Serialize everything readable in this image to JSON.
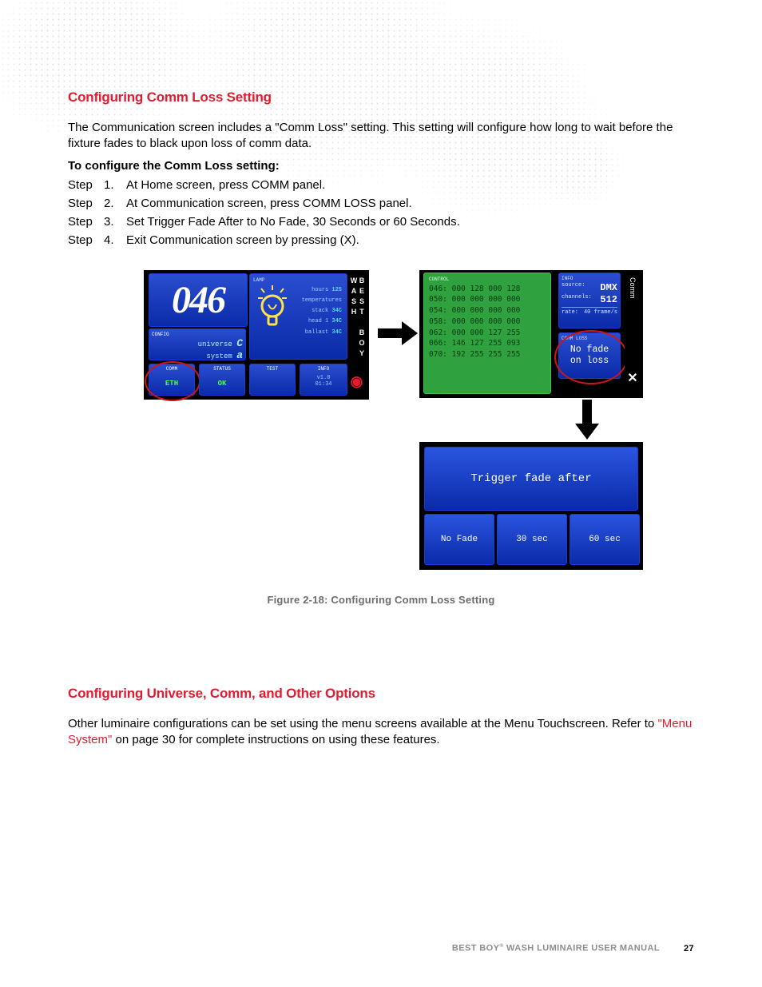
{
  "section1": {
    "heading": "Configuring Comm Loss Setting",
    "intro": "The Communication screen includes a \"Comm Loss\" setting. This setting will configure how long to wait before the fixture fades to black upon loss of comm data.",
    "subhead": "To configure the Comm Loss setting:",
    "step_label": "Step",
    "steps": [
      "At Home screen, press COMM panel.",
      "At Communication screen, press COMM LOSS panel.",
      "Set Trigger Fade After to No Fade, 30 Seconds or 60 Seconds.",
      "Exit Communication screen by pressing (X)."
    ]
  },
  "figure": {
    "caption": "Figure 2-18:  Configuring Comm Loss Setting",
    "home": {
      "address": "046",
      "config_label": "CONFIG",
      "universe_label": "universe",
      "universe_value": "C",
      "system_label": "system",
      "system_value": "a",
      "comm": {
        "label": "COMM",
        "value": "ETH"
      },
      "status": {
        "label": "STATUS",
        "value": "OK"
      },
      "test": {
        "label": "TEST",
        "value": ""
      },
      "info": {
        "label": "INFO",
        "value1": "v1.0",
        "value2": "01:34"
      },
      "lamp": {
        "label": "LAMP",
        "hours_label": "hours",
        "hours_value": "125",
        "temperatures_label": "temperatures",
        "stack_label": "stack",
        "stack_value": "34C",
        "head1_label": "head 1",
        "head1_value": "34C",
        "ballast_label": "ballast",
        "ballast_value": "34C"
      },
      "side_label": "BEST BOY WASH"
    },
    "comm": {
      "control_label": "CONTROL",
      "control_rows": [
        "046: 000 128 000 128",
        "050: 000 000 000 000",
        "054: 000 000 000 000",
        "058: 000 000 000 000",
        "062: 000 000 127 255",
        "066: 146 127 255 093",
        "070: 192 255 255 255"
      ],
      "info": {
        "label": "INFO",
        "source_label": "source:",
        "source_value": "DMX",
        "channels_label": "channels:",
        "channels_value": "512",
        "rate_label": "rate:",
        "rate_value": "40 frame/s"
      },
      "commloss": {
        "label": "COMM LOSS",
        "value_line1": "No fade",
        "value_line2": "on loss"
      },
      "side_label": "Comm",
      "close": "✕"
    },
    "trigger": {
      "title": "Trigger fade after",
      "options": [
        "No Fade",
        "30 sec",
        "60 sec"
      ]
    }
  },
  "section2": {
    "heading": "Configuring Universe, Comm, and Other Options",
    "body_pre": "Other luminaire configurations can be set using the menu screens available at the Menu Touchscreen. Refer to ",
    "link": "\"Menu System\"",
    "body_post": " on page 30 for complete instructions on using these features."
  },
  "footer": {
    "text_left": "BEST BOY",
    "text_right": " WASH LUMINAIRE USER MANUAL",
    "reg": "®",
    "page": "27"
  }
}
